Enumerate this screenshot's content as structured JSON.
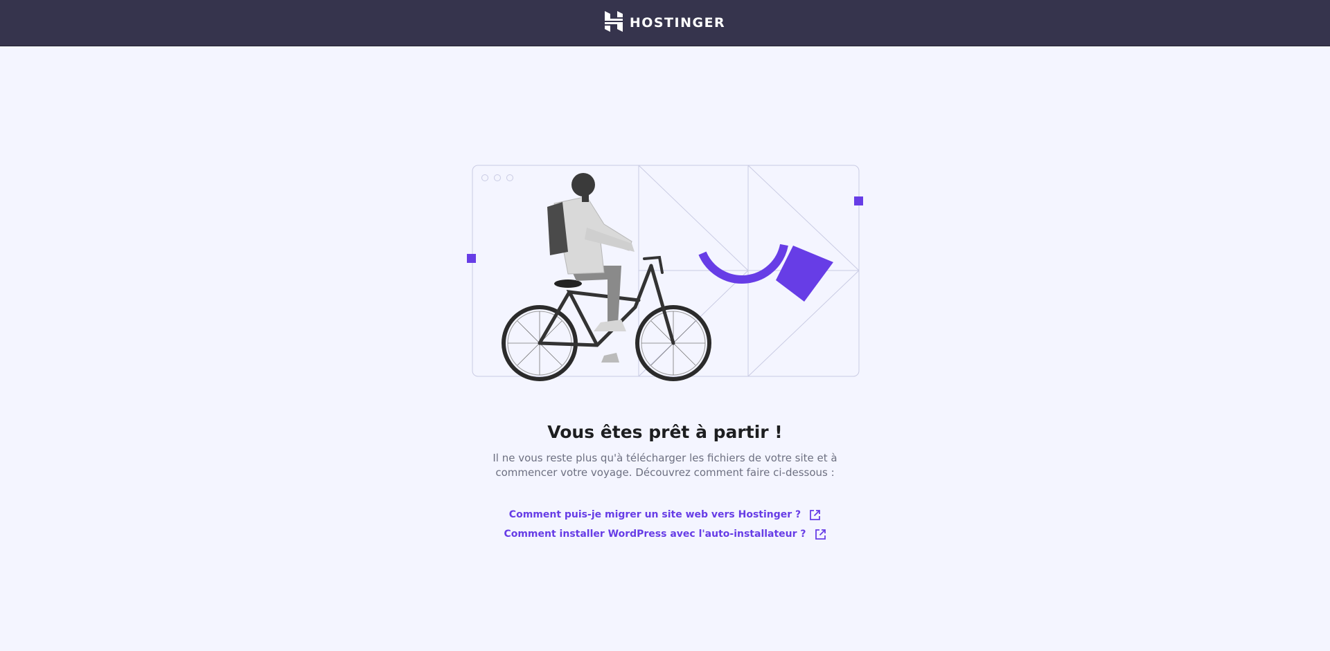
{
  "header": {
    "brand_name": "HOSTINGER",
    "logo_icon": "hostinger-h-logo-icon",
    "background_color": "#36344d"
  },
  "illustration": {
    "window_controls": [
      "circle",
      "circle",
      "circle"
    ],
    "subject": "person-riding-bicycle",
    "accent_color": "#673de6"
  },
  "main": {
    "title": "Vous êtes prêt à partir !",
    "subtitle": "Il ne vous reste plus qu'à télécharger les fichiers de votre site et à commencer votre voyage. Découvrez comment faire ci-dessous :",
    "links": [
      {
        "label": "Comment puis-je migrer un site web vers Hostinger ?",
        "icon": "external-link-icon"
      },
      {
        "label": "Comment installer WordPress avec l'auto-installateur ?",
        "icon": "external-link-icon"
      }
    ]
  },
  "colors": {
    "page_background": "#f4f5ff",
    "link": "#673de6",
    "heading": "#1d1e20",
    "body_text": "#6d7081"
  }
}
